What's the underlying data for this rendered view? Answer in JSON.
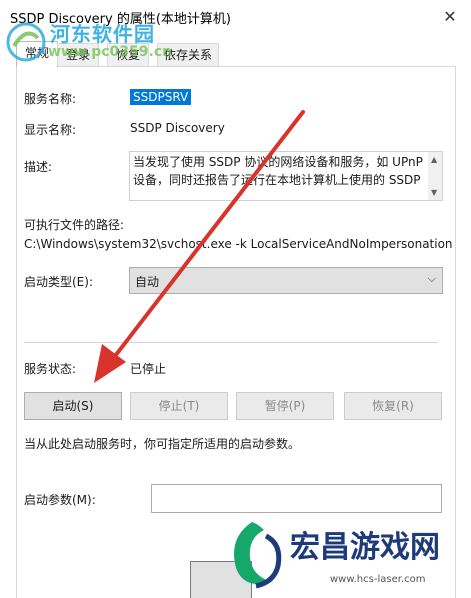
{
  "window": {
    "title": "SSDP Discovery 的属性(本地计算机)",
    "close_glyph": "✕"
  },
  "tabs": [
    {
      "label": "常规"
    },
    {
      "label": "登录"
    },
    {
      "label": "恢复"
    },
    {
      "label": "依存关系"
    }
  ],
  "general": {
    "service_name_label": "服务名称:",
    "service_name_value": "SSDPSRV",
    "display_name_label": "显示名称:",
    "display_name_value": "SSDP Discovery",
    "description_label": "描述:",
    "description_value": "当发现了使用 SSDP 协议的网络设备和服务，如 UPnP 设备，同时还报告了运行在本地计算机上使用的 SSDP",
    "path_label": "可执行文件的路径:",
    "path_value": "C:\\Windows\\system32\\svchost.exe -k LocalServiceAndNoImpersonation",
    "startup_type_label": "启动类型(E):",
    "startup_type_value": "自动",
    "status_label": "服务状态:",
    "status_value": "已停止",
    "buttons": {
      "start": "启动(S)",
      "stop": "停止(T)",
      "pause": "暂停(P)",
      "resume": "恢复(R)"
    },
    "hint": "当从此处启动服务时，你可指定所适用的启动参数。",
    "start_params_label": "启动参数(M):",
    "start_params_value": ""
  },
  "watermarks": {
    "top_title": "河东软件园",
    "top_url": "www.pc0359.cn",
    "bottom_title": "宏昌游戏网",
    "bottom_url": "www.hcs-laser.com"
  },
  "colors": {
    "selection": "#0078d7",
    "arrow": "#d9342b"
  }
}
